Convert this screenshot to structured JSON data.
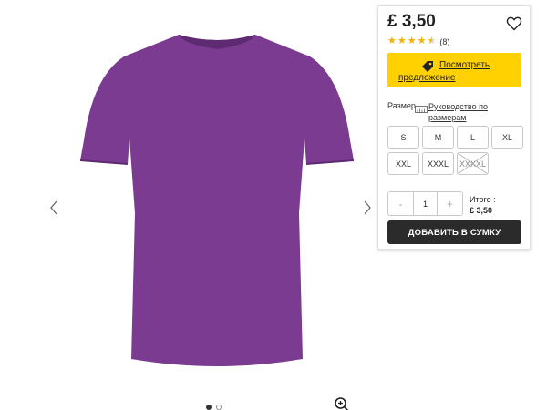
{
  "colors": {
    "accent": "#ffd100",
    "star": "#f2b203",
    "button": "#2b2b2b",
    "shirt": "#7a3b91"
  },
  "gallery": {
    "image_alt": "purple-tshirt",
    "icons": {
      "prev": "chevron-left-icon",
      "next": "chevron-right-icon",
      "zoom": "zoom-in-icon"
    },
    "dots": [
      true,
      false
    ]
  },
  "product": {
    "price": "£ 3,50",
    "rating": {
      "stars": 4.5,
      "count": "(8)"
    },
    "offer": {
      "line1": "Посмотреть",
      "line2": "предложение",
      "icon": "tag-icon"
    },
    "size_label": "Размер",
    "size_guide": "Руководство по размерам",
    "sizes": [
      {
        "label": "S",
        "available": true
      },
      {
        "label": "M",
        "available": true
      },
      {
        "label": "L",
        "available": true
      },
      {
        "label": "XL",
        "available": true
      },
      {
        "label": "XXL",
        "available": true
      },
      {
        "label": "XXXL",
        "available": true
      },
      {
        "label": "XXXXL",
        "available": false
      }
    ],
    "quantity": {
      "minus": "-",
      "value": "1",
      "plus": "+"
    },
    "total_label": "Итого :",
    "total_value": "£ 3,50",
    "add_button": "ДОБАВИТЬ В СУМКУ"
  }
}
